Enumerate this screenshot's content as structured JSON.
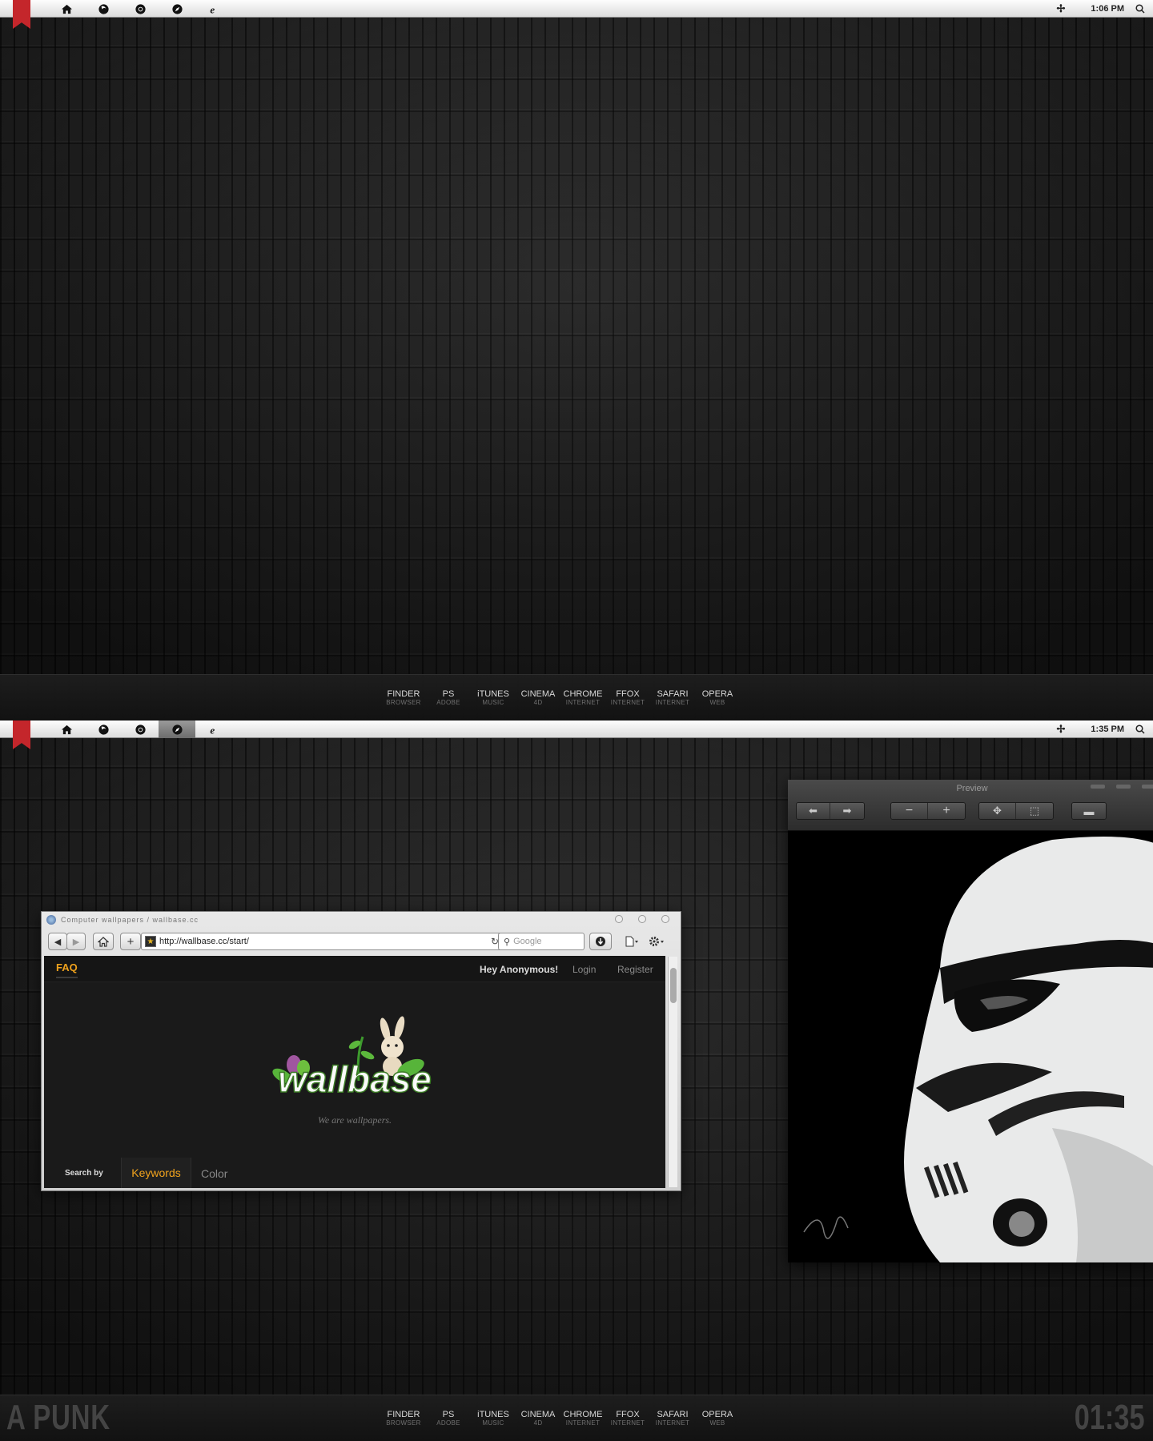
{
  "screen1": {
    "menubar": {
      "icons": [
        "home-icon",
        "firefox-icon",
        "chrome-icon",
        "safari-icon",
        "ie-icon"
      ],
      "clock": "1:06 PM"
    }
  },
  "screen2": {
    "menubar": {
      "icons": [
        "home-icon",
        "firefox-icon",
        "chrome-icon",
        "safari-icon",
        "ie-icon"
      ],
      "active_icon": "safari-icon",
      "clock": "1:35 PM"
    },
    "browser": {
      "title": "Computer wallpapers / wallbase.cc",
      "url": "http://wallbase.cc/start/",
      "search_placeholder": "Google",
      "site": {
        "faq": "FAQ",
        "greeting": "Hey Anonymous!",
        "login": "Login",
        "register": "Register",
        "logo": "wallbase",
        "tagline": "We are wallpapers.",
        "search_by_label": "Search by",
        "tabs": [
          "Keywords",
          "Color"
        ],
        "active_tab": "Keywords",
        "accent_color": "#f0a21d"
      }
    },
    "preview": {
      "title": "Preview"
    },
    "dock_left": "A PUNK",
    "dock_right": "01:35"
  },
  "dock": {
    "items": [
      {
        "name": "FINDER",
        "sub": "BROWSER"
      },
      {
        "name": "PS",
        "sub": "ADOBE"
      },
      {
        "name": "iTUNES",
        "sub": "MUSIC"
      },
      {
        "name": "CINEMA",
        "sub": "4D"
      },
      {
        "name": "CHROME",
        "sub": "INTERNET"
      },
      {
        "name": "FFOX",
        "sub": "INTERNET"
      },
      {
        "name": "SAFARI",
        "sub": "INTERNET"
      },
      {
        "name": "OPERA",
        "sub": "WEB"
      }
    ]
  },
  "colors": {
    "ribbon": "#c4262b",
    "menubar": "#ececec",
    "wallpaper": "#1b1b1b"
  }
}
